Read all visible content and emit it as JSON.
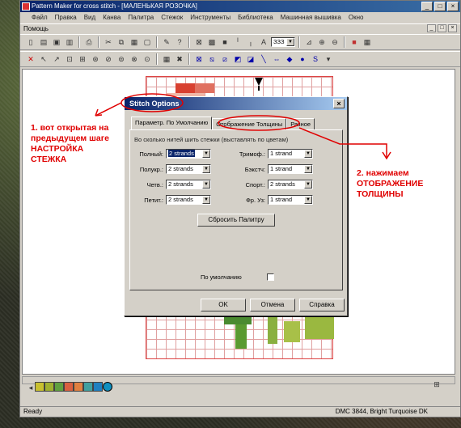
{
  "window": {
    "title": "Pattern Maker for cross stitch - [МАЛЕНЬКАЯ РОЗОЧКА]",
    "buttons": [
      "_",
      "□",
      "×"
    ]
  },
  "menu": [
    "Файл",
    "Правка",
    "Вид",
    "Канва",
    "Палитра",
    "Стежок",
    "Инструменты",
    "Библиотека",
    "Машинная вышивка",
    "Окно"
  ],
  "mdi": {
    "label": "Помощь",
    "buttons": [
      "_",
      "□",
      "×"
    ]
  },
  "toolbar": {
    "font_name": "ЗЗЗ"
  },
  "dialog": {
    "title": "Stitch Options",
    "close": "×",
    "tabs": [
      "Параметр. По Умолчанию",
      "Отображение Толщины",
      "Разное"
    ],
    "caption": "Во сколько нитей шить стежки (выставлять по цветам)",
    "left_fields": [
      {
        "label": "Полный:",
        "value": "2 strands",
        "selected": true
      },
      {
        "label": "Полукр.:",
        "value": "2 strands"
      },
      {
        "label": "Четв.:",
        "value": "2 strands"
      },
      {
        "label": "Петит.:",
        "value": "2 strands"
      }
    ],
    "right_fields": [
      {
        "label": "Тримоф.:",
        "value": "1 strand"
      },
      {
        "label": "Бэкстч:",
        "value": "1 strand"
      },
      {
        "label": "Спорт.:",
        "value": "2 strands"
      },
      {
        "label": "Фр. Уз:",
        "value": "1 strand"
      }
    ],
    "reset_button": "Сбросить Палитру",
    "default_checkbox": "По умолчанию",
    "ok": "OK",
    "cancel": "Отмена",
    "help": "Справка"
  },
  "annotations": {
    "note1": "1. вот открытая на предыдущем шаге НАСТРОЙКА СТЕЖКА",
    "note2": "2. нажимаем ОТОБРАЖЕНИЕ ТОЛЩИНЫ"
  },
  "palette": {
    "colors": [
      "#c8c030",
      "#a0b030",
      "#60a040",
      "#d86040",
      "#e08040",
      "#40a0a0",
      "#2080c0",
      "#1090c0"
    ],
    "selected_index": 7
  },
  "status": {
    "left": "Ready",
    "right": "DMC 3844, Bright Turquoise DK"
  },
  "colors": {
    "annotation": "#e00000",
    "titlebar": "#0a246a"
  }
}
